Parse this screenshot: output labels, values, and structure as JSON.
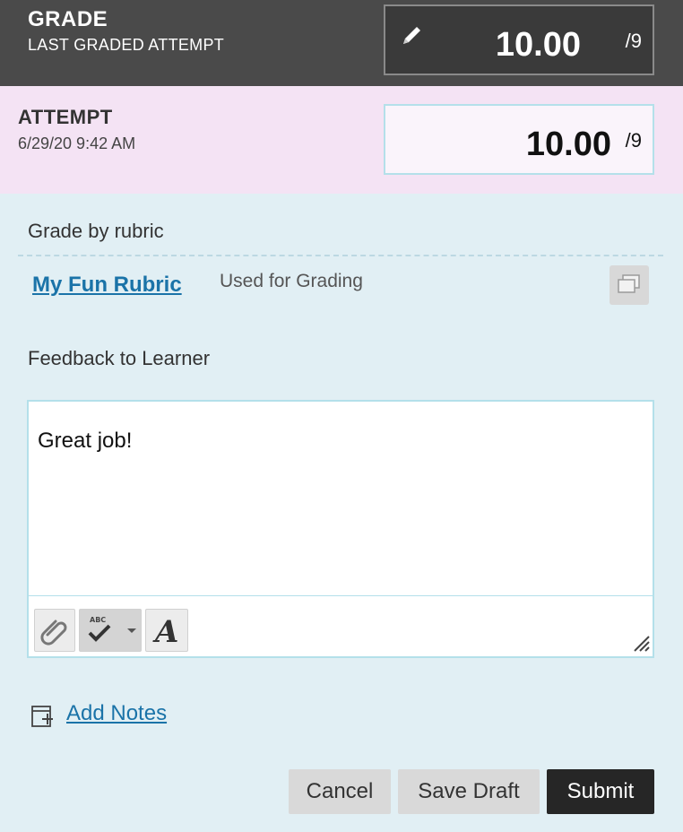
{
  "grade": {
    "title": "GRADE",
    "subtitle": "LAST GRADED ATTEMPT",
    "value": "10.00",
    "max": "/9"
  },
  "attempt": {
    "title": "ATTEMPT",
    "datetime": "6/29/20 9:42 AM",
    "value": "10.00",
    "max": "/9"
  },
  "rubric": {
    "section_label": "Grade by rubric",
    "link_label": "My Fun Rubric",
    "status": "Used for Grading"
  },
  "feedback": {
    "label": "Feedback to Learner",
    "text": "Great job!"
  },
  "notes": {
    "label": "Add Notes"
  },
  "buttons": {
    "cancel": "Cancel",
    "save_draft": "Save Draft",
    "submit": "Submit"
  },
  "colors": {
    "header_bg": "#4a4a4a",
    "attempt_bg": "#f4e3f4",
    "panel_bg": "#e1eff4",
    "link": "#1a73a8",
    "submit_bg": "#262626"
  },
  "icons": [
    "pencil-icon",
    "expand-window-icon",
    "attachment-icon",
    "spellcheck-icon",
    "dropdown-caret-icon",
    "font-format-icon",
    "resize-handle-icon",
    "add-note-icon"
  ]
}
